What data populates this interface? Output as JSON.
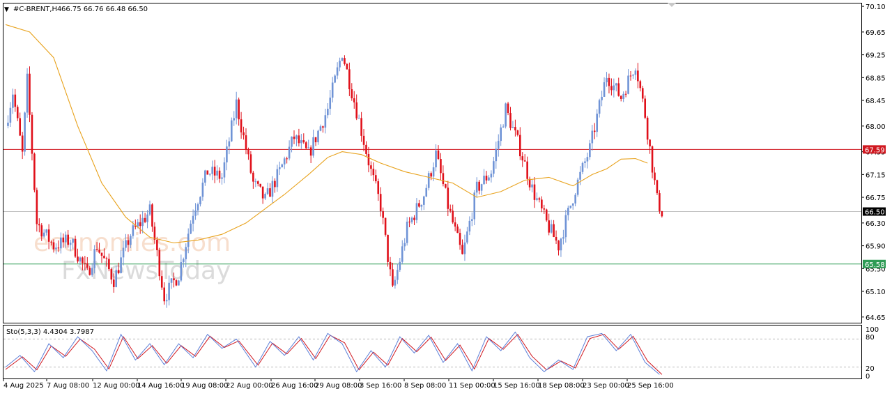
{
  "header": {
    "menu_glyph": "▼",
    "symbol": "#C-BRENT,H4",
    "ohlc": "66.75 66.76 66.48 66.50"
  },
  "stochastic": {
    "label": "Sto(5,3,3) 4.4304 3.7987",
    "scale_labels": [
      "100",
      "80",
      "20",
      "0"
    ],
    "level_values": [
      100,
      80,
      20,
      0
    ]
  },
  "watermark": {
    "line1": "economies.com",
    "line2": "FxNewsToday"
  },
  "colors": {
    "bull": "#6f93d6",
    "bear": "#e0101a",
    "ma": "#e8a21c",
    "resistance": "#d01820",
    "support": "#2e9b55",
    "stoch_main": "#5c7fd8",
    "stoch_signal": "#d01820"
  },
  "chart_data": {
    "type": "candlestick",
    "symbol": "#C-BRENT",
    "timeframe": "H4",
    "ylim": [
      64.55,
      70.15
    ],
    "y_ticks": [
      70.1,
      69.65,
      69.25,
      68.85,
      68.45,
      68.0,
      67.55,
      67.15,
      66.75,
      66.3,
      65.9,
      65.5,
      65.1,
      64.65
    ],
    "x_labels": [
      "4 Aug 2025",
      "7 Aug 08:00",
      "12 Aug 00:00",
      "14 Aug 16:00",
      "19 Aug 08:00",
      "22 Aug 00:00",
      "26 Aug 16:00",
      "29 Aug 08:00",
      "3 Sep 16:00",
      "8 Sep 08:00",
      "11 Sep 00:00",
      "15 Sep 16:00",
      "18 Sep 08:00",
      "23 Sep 00:00",
      "25 Sep 16:00"
    ],
    "horizontal_lines": [
      {
        "label": "67.59",
        "value": 67.59,
        "role": "resistance"
      },
      {
        "label": "66.50",
        "value": 66.5,
        "role": "current-price"
      },
      {
        "label": "65.58",
        "value": 65.58,
        "role": "support"
      }
    ],
    "price_anchors": [
      [
        0,
        68.0
      ],
      [
        3,
        68.6
      ],
      [
        7,
        67.5
      ],
      [
        9,
        68.8
      ],
      [
        13,
        66.3
      ],
      [
        20,
        65.9
      ],
      [
        27,
        66.0
      ],
      [
        34,
        65.4
      ],
      [
        38,
        65.9
      ],
      [
        45,
        65.3
      ],
      [
        52,
        66.1
      ],
      [
        60,
        66.5
      ],
      [
        66,
        65.0
      ],
      [
        72,
        65.4
      ],
      [
        78,
        66.5
      ],
      [
        84,
        67.2
      ],
      [
        90,
        67.1
      ],
      [
        96,
        68.4
      ],
      [
        103,
        67.0
      ],
      [
        108,
        66.7
      ],
      [
        114,
        67.2
      ],
      [
        120,
        67.8
      ],
      [
        126,
        67.5
      ],
      [
        134,
        68.3
      ],
      [
        140,
        69.3
      ],
      [
        147,
        68.1
      ],
      [
        152,
        67.2
      ],
      [
        156,
        66.6
      ],
      [
        161,
        65.1
      ],
      [
        167,
        66.2
      ],
      [
        174,
        66.8
      ],
      [
        179,
        67.5
      ],
      [
        184,
        66.6
      ],
      [
        190,
        65.7
      ],
      [
        196,
        66.9
      ],
      [
        202,
        67.2
      ],
      [
        208,
        68.3
      ],
      [
        214,
        67.6
      ],
      [
        219,
        66.9
      ],
      [
        225,
        66.3
      ],
      [
        230,
        65.9
      ],
      [
        237,
        66.9
      ],
      [
        243,
        67.6
      ],
      [
        250,
        68.9
      ],
      [
        256,
        68.5
      ],
      [
        262,
        69.1
      ],
      [
        266,
        68.2
      ],
      [
        271,
        66.7
      ],
      [
        273,
        66.5
      ]
    ],
    "moving_average": {
      "color": "#e8a21c",
      "points": [
        [
          0,
          69.78
        ],
        [
          10,
          69.65
        ],
        [
          20,
          69.2
        ],
        [
          30,
          68.0
        ],
        [
          40,
          67.0
        ],
        [
          50,
          66.4
        ],
        [
          60,
          66.05
        ],
        [
          70,
          65.95
        ],
        [
          80,
          66.0
        ],
        [
          90,
          66.1
        ],
        [
          100,
          66.3
        ],
        [
          108,
          66.55
        ],
        [
          116,
          66.8
        ],
        [
          126,
          67.15
        ],
        [
          134,
          67.45
        ],
        [
          140,
          67.55
        ],
        [
          148,
          67.5
        ],
        [
          156,
          67.35
        ],
        [
          166,
          67.2
        ],
        [
          176,
          67.1
        ],
        [
          186,
          67.0
        ],
        [
          196,
          66.75
        ],
        [
          206,
          66.85
        ],
        [
          216,
          67.05
        ],
        [
          226,
          67.1
        ],
        [
          236,
          66.95
        ],
        [
          244,
          67.15
        ],
        [
          250,
          67.25
        ],
        [
          256,
          67.42
        ],
        [
          262,
          67.43
        ],
        [
          267,
          67.35
        ]
      ]
    },
    "stochastic": {
      "ylim": [
        0,
        100
      ],
      "levels": [
        80,
        20
      ],
      "main": [
        [
          0,
          20
        ],
        [
          6,
          45
        ],
        [
          12,
          10
        ],
        [
          18,
          70
        ],
        [
          24,
          40
        ],
        [
          30,
          85
        ],
        [
          36,
          55
        ],
        [
          42,
          12
        ],
        [
          48,
          90
        ],
        [
          54,
          35
        ],
        [
          60,
          70
        ],
        [
          66,
          25
        ],
        [
          72,
          70
        ],
        [
          78,
          40
        ],
        [
          84,
          90
        ],
        [
          90,
          60
        ],
        [
          96,
          80
        ],
        [
          104,
          20
        ],
        [
          110,
          75
        ],
        [
          116,
          45
        ],
        [
          122,
          85
        ],
        [
          128,
          35
        ],
        [
          134,
          92
        ],
        [
          140,
          70
        ],
        [
          146,
          10
        ],
        [
          152,
          55
        ],
        [
          158,
          20
        ],
        [
          164,
          85
        ],
        [
          170,
          50
        ],
        [
          176,
          88
        ],
        [
          182,
          30
        ],
        [
          188,
          70
        ],
        [
          194,
          12
        ],
        [
          200,
          85
        ],
        [
          206,
          55
        ],
        [
          212,
          95
        ],
        [
          218,
          40
        ],
        [
          224,
          10
        ],
        [
          230,
          35
        ],
        [
          236,
          15
        ],
        [
          242,
          85
        ],
        [
          248,
          92
        ],
        [
          254,
          55
        ],
        [
          260,
          90
        ],
        [
          266,
          30
        ],
        [
          272,
          4
        ]
      ],
      "signal": [
        [
          0,
          15
        ],
        [
          7,
          42
        ],
        [
          13,
          14
        ],
        [
          19,
          65
        ],
        [
          25,
          43
        ],
        [
          31,
          80
        ],
        [
          37,
          58
        ],
        [
          43,
          16
        ],
        [
          49,
          85
        ],
        [
          55,
          38
        ],
        [
          61,
          66
        ],
        [
          67,
          28
        ],
        [
          73,
          66
        ],
        [
          79,
          43
        ],
        [
          85,
          86
        ],
        [
          91,
          62
        ],
        [
          97,
          76
        ],
        [
          105,
          24
        ],
        [
          111,
          71
        ],
        [
          117,
          48
        ],
        [
          123,
          81
        ],
        [
          129,
          38
        ],
        [
          135,
          88
        ],
        [
          141,
          72
        ],
        [
          147,
          14
        ],
        [
          153,
          52
        ],
        [
          159,
          24
        ],
        [
          165,
          81
        ],
        [
          171,
          53
        ],
        [
          177,
          84
        ],
        [
          183,
          34
        ],
        [
          189,
          67
        ],
        [
          195,
          16
        ],
        [
          201,
          81
        ],
        [
          207,
          58
        ],
        [
          213,
          90
        ],
        [
          219,
          43
        ],
        [
          225,
          14
        ],
        [
          231,
          33
        ],
        [
          237,
          18
        ],
        [
          243,
          81
        ],
        [
          249,
          90
        ],
        [
          255,
          58
        ],
        [
          261,
          86
        ],
        [
          267,
          33
        ],
        [
          273,
          4
        ]
      ]
    }
  }
}
